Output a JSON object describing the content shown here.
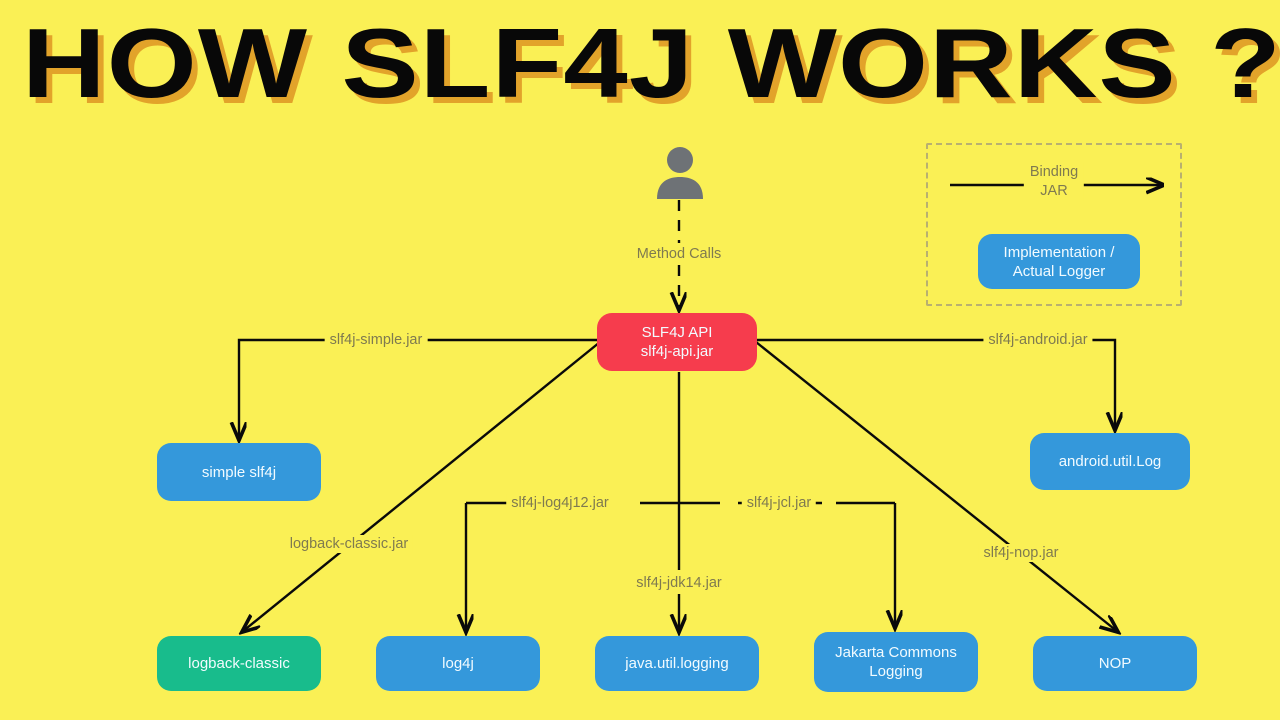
{
  "page": {
    "title": "HOW SLF4J WORKS ?",
    "background_color": "#FAF055",
    "title_color": "#080808",
    "title_shadow_color": "#E2A32A"
  },
  "colors": {
    "api_red": "#F63C4D",
    "impl_blue": "#3498DB",
    "logback_green": "#18BC8C",
    "label_text": "#7F7A50",
    "legend_border": "#B9B070"
  },
  "actor": {
    "icon": "person-icon",
    "edge_label": "Method Calls"
  },
  "api_node": {
    "line1": "SLF4J API",
    "line2": "slf4j-api.jar"
  },
  "legend": {
    "arrow_label_line1": "Binding",
    "arrow_label_line2": "JAR",
    "box_line1": "Implementation /",
    "box_line2": "Actual Logger"
  },
  "bindings": [
    {
      "jar": "slf4j-simple.jar",
      "target": "simple slf4j",
      "color": "blue"
    },
    {
      "jar": "logback-classic.jar",
      "target": "logback-classic",
      "color": "green"
    },
    {
      "jar": "slf4j-log4j12.jar",
      "target": "log4j",
      "color": "blue"
    },
    {
      "jar": "slf4j-jdk14.jar",
      "target": "java.util.logging",
      "color": "blue"
    },
    {
      "jar": "slf4j-jcl.jar",
      "target_line1": "Jakarta Commons",
      "target_line2": "Logging",
      "color": "blue"
    },
    {
      "jar": "slf4j-nop.jar",
      "target": "NOP",
      "color": "blue"
    },
    {
      "jar": "slf4j-android.jar",
      "target": "android.util.Log",
      "color": "blue"
    }
  ]
}
